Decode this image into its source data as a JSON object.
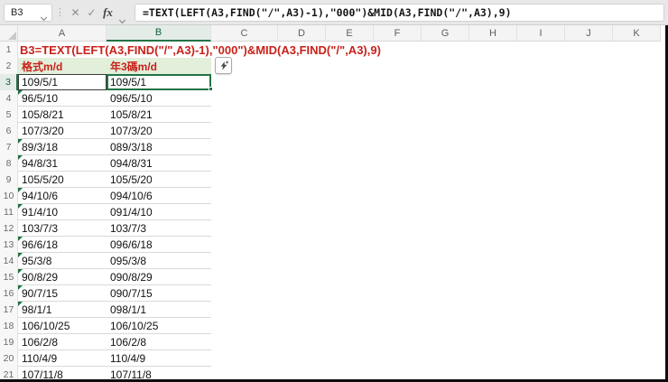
{
  "colors": {
    "red": "#c9211a",
    "green": "#217346",
    "error_green": "#1e7145",
    "header_green_bg": "#e2efda"
  },
  "formula_bar": {
    "name_box_value": "B3",
    "cancel_icon": "✕",
    "enter_icon": "✓",
    "fx_label": "fx",
    "formula": "=TEXT(LEFT(A3,FIND(\"/\",A3)-1),\"000\")&MID(A3,FIND(\"/\",A3),9)"
  },
  "sheet": {
    "columns": [
      "A",
      "B",
      "C",
      "D",
      "E",
      "F",
      "G",
      "H",
      "I",
      "J",
      "K"
    ],
    "selected_column": "B",
    "selected_row": 3,
    "active_cell": "B3",
    "rows": [
      {
        "n": 1,
        "type": "note",
        "text": "B3=TEXT(LEFT(A3,FIND(\"/\",A3)-1),\"000\")&MID(A3,FIND(\"/\",A3),9)"
      },
      {
        "n": 2,
        "type": "header",
        "a": "格式m/d",
        "b": "年3碼m/d"
      },
      {
        "n": 3,
        "type": "data",
        "a": "109/5/1",
        "b": "109/5/1",
        "err": false,
        "active": true
      },
      {
        "n": 4,
        "type": "data",
        "a": "96/5/10",
        "b": "096/5/10",
        "err": true
      },
      {
        "n": 5,
        "type": "data",
        "a": "105/8/21",
        "b": "105/8/21",
        "err": false
      },
      {
        "n": 6,
        "type": "data",
        "a": "107/3/20",
        "b": "107/3/20",
        "err": false
      },
      {
        "n": 7,
        "type": "data",
        "a": "89/3/18",
        "b": "089/3/18",
        "err": true
      },
      {
        "n": 8,
        "type": "data",
        "a": "94/8/31",
        "b": "094/8/31",
        "err": true
      },
      {
        "n": 9,
        "type": "data",
        "a": "105/5/20",
        "b": "105/5/20",
        "err": false
      },
      {
        "n": 10,
        "type": "data",
        "a": "94/10/6",
        "b": "094/10/6",
        "err": true
      },
      {
        "n": 11,
        "type": "data",
        "a": "91/4/10",
        "b": "091/4/10",
        "err": true
      },
      {
        "n": 12,
        "type": "data",
        "a": "103/7/3",
        "b": "103/7/3",
        "err": false
      },
      {
        "n": 13,
        "type": "data",
        "a": "96/6/18",
        "b": "096/6/18",
        "err": true
      },
      {
        "n": 14,
        "type": "data",
        "a": "95/3/8",
        "b": "095/3/8",
        "err": true
      },
      {
        "n": 15,
        "type": "data",
        "a": "90/8/29",
        "b": "090/8/29",
        "err": true
      },
      {
        "n": 16,
        "type": "data",
        "a": "90/7/15",
        "b": "090/7/15",
        "err": true
      },
      {
        "n": 17,
        "type": "data",
        "a": "98/1/1",
        "b": "098/1/1",
        "err": true
      },
      {
        "n": 18,
        "type": "data",
        "a": "106/10/25",
        "b": "106/10/25",
        "err": false
      },
      {
        "n": 19,
        "type": "data",
        "a": "106/2/8",
        "b": "106/2/8",
        "err": false
      },
      {
        "n": 20,
        "type": "data",
        "a": "110/4/9",
        "b": "110/4/9",
        "err": false
      },
      {
        "n": 21,
        "type": "data",
        "a": "107/11/8",
        "b": "107/11/8",
        "err": false
      }
    ]
  }
}
